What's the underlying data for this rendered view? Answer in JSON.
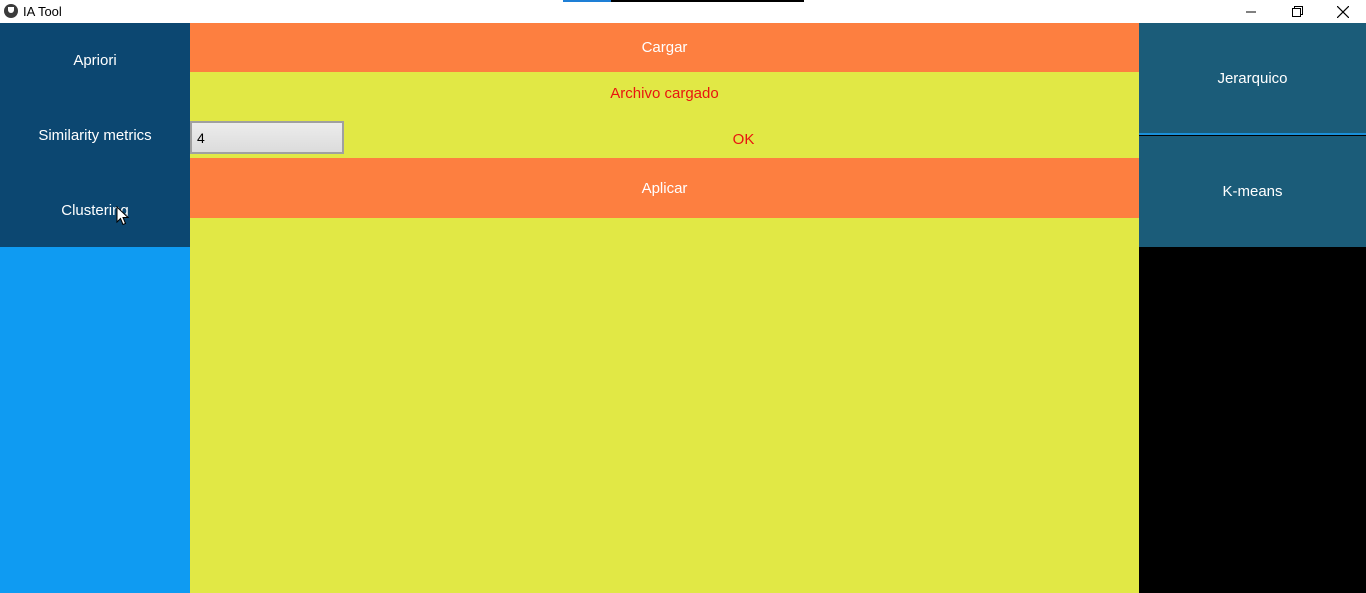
{
  "window": {
    "title": "IA Tool",
    "progress_fraction": 0.2
  },
  "sidebar": {
    "items": [
      {
        "label": "Apriori"
      },
      {
        "label": "Similarity metrics"
      },
      {
        "label": "Clustering"
      }
    ]
  },
  "main": {
    "load_button": "Cargar",
    "status": "Archivo cargado",
    "k_value": "4",
    "ok_button": "OK",
    "apply_button": "Aplicar"
  },
  "right_menu": {
    "items": [
      {
        "label": "Jerarquico"
      },
      {
        "label": "K-means"
      }
    ]
  },
  "colors": {
    "sidebar_bg": "#0c4771",
    "sidebar_fill": "#0f9bf2",
    "main_bg": "#e1e845",
    "orange_button": "#fd7f40",
    "status_text": "#e8140f",
    "right_button": "#1b5c79"
  }
}
